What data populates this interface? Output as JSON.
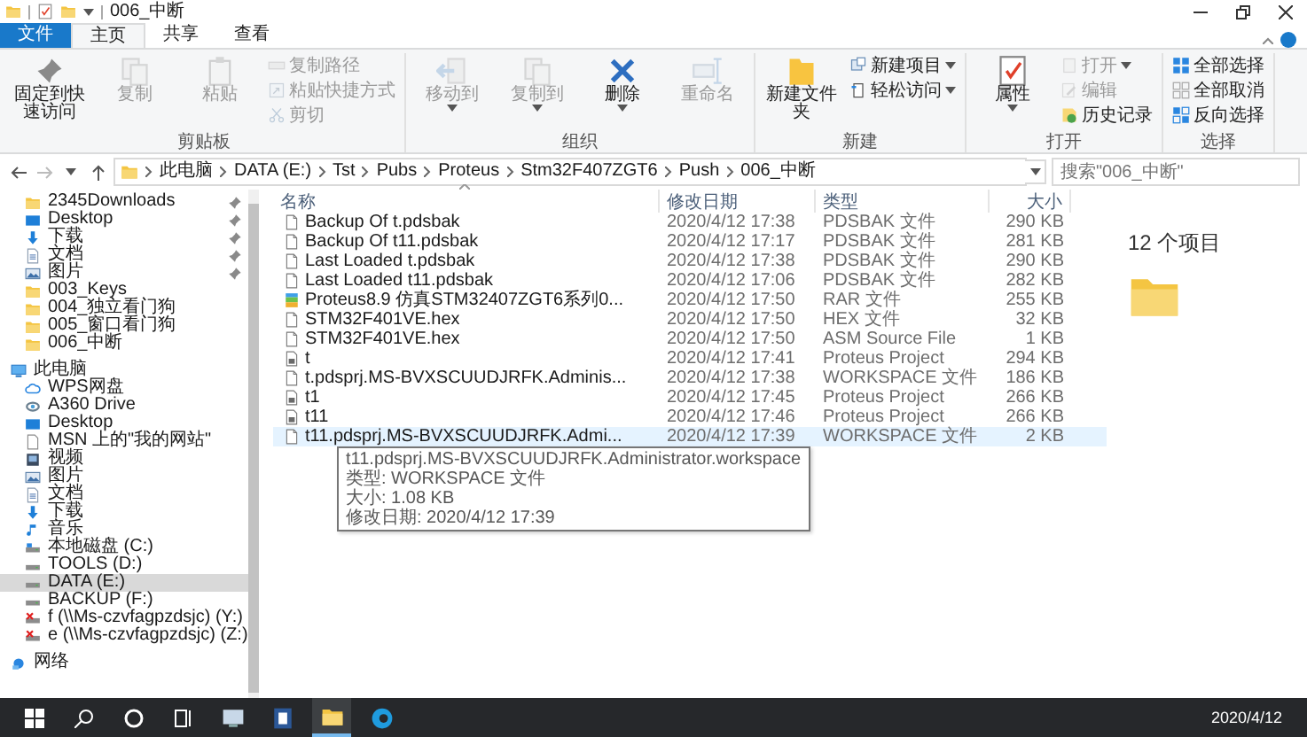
{
  "window": {
    "title": "006_中断"
  },
  "ribbon_tabs": [
    {
      "label": "文件",
      "kind": "file",
      "selected": false
    },
    {
      "label": "主页",
      "kind": "tab",
      "selected": true
    },
    {
      "label": "共享",
      "kind": "tab",
      "selected": false
    },
    {
      "label": "查看",
      "kind": "tab",
      "selected": false
    }
  ],
  "ribbon_groups": [
    {
      "label": "剪贴板",
      "items": [
        {
          "label": "固定到快速访问",
          "kind": "large",
          "disabled": false,
          "dropdown": false
        },
        {
          "label": "复制",
          "kind": "large",
          "disabled": true,
          "dropdown": false
        },
        {
          "label": "粘贴",
          "kind": "large",
          "disabled": true,
          "dropdown": false
        },
        {
          "label": "复制路径",
          "kind": "small",
          "disabled": true,
          "dropdown": false
        },
        {
          "label": "粘贴快捷方式",
          "kind": "small",
          "disabled": true,
          "dropdown": false
        },
        {
          "label": "剪切",
          "kind": "small",
          "disabled": true,
          "dropdown": false
        }
      ]
    },
    {
      "label": "组织",
      "items": [
        {
          "label": "移动到",
          "kind": "large",
          "disabled": true,
          "dropdown": true
        },
        {
          "label": "复制到",
          "kind": "large",
          "disabled": true,
          "dropdown": true
        },
        {
          "label": "删除",
          "kind": "large",
          "disabled": false,
          "dropdown": true
        },
        {
          "label": "重命名",
          "kind": "large",
          "disabled": true,
          "dropdown": false
        }
      ]
    },
    {
      "label": "新建",
      "items": [
        {
          "label": "新建文件夹",
          "kind": "large",
          "disabled": false,
          "dropdown": false
        },
        {
          "label": "新建项目",
          "kind": "small",
          "disabled": false,
          "dropdown": true
        },
        {
          "label": "轻松访问",
          "kind": "small",
          "disabled": false,
          "dropdown": true
        }
      ]
    },
    {
      "label": "打开",
      "items": [
        {
          "label": "属性",
          "kind": "large",
          "disabled": false,
          "dropdown": true
        },
        {
          "label": "打开",
          "kind": "small",
          "disabled": true,
          "dropdown": true
        },
        {
          "label": "编辑",
          "kind": "small",
          "disabled": true,
          "dropdown": false
        },
        {
          "label": "历史记录",
          "kind": "small",
          "disabled": false,
          "dropdown": false
        }
      ]
    },
    {
      "label": "选择",
      "items": [
        {
          "label": "全部选择",
          "kind": "small",
          "disabled": false,
          "dropdown": false
        },
        {
          "label": "全部取消",
          "kind": "small",
          "disabled": false,
          "dropdown": false
        },
        {
          "label": "反向选择",
          "kind": "small",
          "disabled": false,
          "dropdown": false
        }
      ]
    }
  ],
  "address": {
    "segments": [
      "此电脑",
      "DATA (E:)",
      "Tst",
      "Pubs",
      "Proteus",
      "Stm32F407ZGT6",
      "Push",
      "006_中断"
    ]
  },
  "search": {
    "placeholder": "搜索\"006_中断\""
  },
  "quick_access": [
    {
      "label": "2345Downloads",
      "kind": "folder",
      "pinned": true
    },
    {
      "label": "Desktop",
      "kind": "desktop",
      "pinned": true
    },
    {
      "label": "下载",
      "kind": "download",
      "pinned": true
    },
    {
      "label": "文档",
      "kind": "doc",
      "pinned": true
    },
    {
      "label": "图片",
      "kind": "picture",
      "pinned": true
    },
    {
      "label": "003_Keys",
      "kind": "folder",
      "pinned": false
    },
    {
      "label": "004_独立看门狗",
      "kind": "folder",
      "pinned": false
    },
    {
      "label": "005_窗口看门狗",
      "kind": "folder",
      "pinned": false
    },
    {
      "label": "006_中断",
      "kind": "folder",
      "pinned": false
    }
  ],
  "nav_tree": [
    {
      "label": "此电脑",
      "kind": "pc",
      "selected": false,
      "children": [
        {
          "label": "WPS网盘",
          "kind": "cloud",
          "selected": false
        },
        {
          "label": "A360 Drive",
          "kind": "swirl",
          "selected": false
        },
        {
          "label": "Desktop",
          "kind": "desktop",
          "selected": false
        },
        {
          "label": "MSN 上的\"我的网站\"",
          "kind": "page",
          "selected": false
        },
        {
          "label": "视频",
          "kind": "video",
          "selected": false
        },
        {
          "label": "图片",
          "kind": "picture",
          "selected": false
        },
        {
          "label": "文档",
          "kind": "doc",
          "selected": false
        },
        {
          "label": "下载",
          "kind": "download",
          "selected": false
        },
        {
          "label": "音乐",
          "kind": "music",
          "selected": false
        },
        {
          "label": "本地磁盘 (C:)",
          "kind": "system_drive",
          "selected": false
        },
        {
          "label": "TOOLS (D:)",
          "kind": "drive",
          "selected": false
        },
        {
          "label": "DATA (E:)",
          "kind": "drive",
          "selected": true
        },
        {
          "label": "BACKUP (F:)",
          "kind": "drive",
          "selected": false
        },
        {
          "label": "f (\\\\Ms-czvfagpzdsjc) (Y:)",
          "kind": "netdrive",
          "selected": false
        },
        {
          "label": "e (\\\\Ms-czvfagpzdsjc) (Z:)",
          "kind": "netdrive",
          "selected": false
        }
      ]
    },
    {
      "label": "网络",
      "kind": "network",
      "selected": false
    }
  ],
  "table": {
    "columns": [
      "名称",
      "修改日期",
      "类型",
      "大小"
    ],
    "rows": [
      {
        "name": "Backup Of t.pdsbak",
        "date": "2020/4/12 17:38",
        "type": "PDSBAK 文件",
        "size": "290 KB",
        "kind": "file",
        "hovered": false
      },
      {
        "name": "Backup Of t11.pdsbak",
        "date": "2020/4/12 17:17",
        "type": "PDSBAK 文件",
        "size": "281 KB",
        "kind": "file",
        "hovered": false
      },
      {
        "name": "Last Loaded t.pdsbak",
        "date": "2020/4/12 17:38",
        "type": "PDSBAK 文件",
        "size": "290 KB",
        "kind": "file",
        "hovered": false
      },
      {
        "name": "Last Loaded t11.pdsbak",
        "date": "2020/4/12 17:06",
        "type": "PDSBAK 文件",
        "size": "282 KB",
        "kind": "file",
        "hovered": false
      },
      {
        "name": "Proteus8.9 仿真STM32407ZGT6系列0...",
        "date": "2020/4/12 17:50",
        "type": "RAR 文件",
        "size": "255 KB",
        "kind": "archive",
        "hovered": false
      },
      {
        "name": "STM32F401VE.hex",
        "date": "2020/4/12 17:50",
        "type": "HEX 文件",
        "size": "32 KB",
        "kind": "file",
        "hovered": false
      },
      {
        "name": "STM32F401VE.hex",
        "date": "2020/4/12 17:50",
        "type": "ASM Source File",
        "size": "1 KB",
        "kind": "file",
        "hovered": false
      },
      {
        "name": "t",
        "date": "2020/4/12 17:41",
        "type": "Proteus Project",
        "size": "294 KB",
        "kind": "project",
        "hovered": false
      },
      {
        "name": "t.pdsprj.MS-BVXSCUUDJRFK.Adminis...",
        "date": "2020/4/12 17:38",
        "type": "WORKSPACE 文件",
        "size": "186 KB",
        "kind": "file",
        "hovered": false
      },
      {
        "name": "t1",
        "date": "2020/4/12 17:45",
        "type": "Proteus Project",
        "size": "266 KB",
        "kind": "project",
        "hovered": false
      },
      {
        "name": "t11",
        "date": "2020/4/12 17:46",
        "type": "Proteus Project",
        "size": "266 KB",
        "kind": "project",
        "hovered": false
      },
      {
        "name": "t11.pdsprj.MS-BVXSCUUDJRFK.Admi...",
        "date": "2020/4/12 17:39",
        "type": "WORKSPACE 文件",
        "size": "2 KB",
        "kind": "file",
        "hovered": true
      }
    ]
  },
  "tooltip": {
    "lines": [
      "t11.pdsprj.MS-BVXSCUUDJRFK.Administrator.workspace",
      "类型: WORKSPACE 文件",
      "大小: 1.08 KB",
      "修改日期: 2020/4/12 17:39"
    ]
  },
  "details": {
    "count": "12 个项目"
  },
  "taskbar": {
    "date": "2020/4/12"
  }
}
